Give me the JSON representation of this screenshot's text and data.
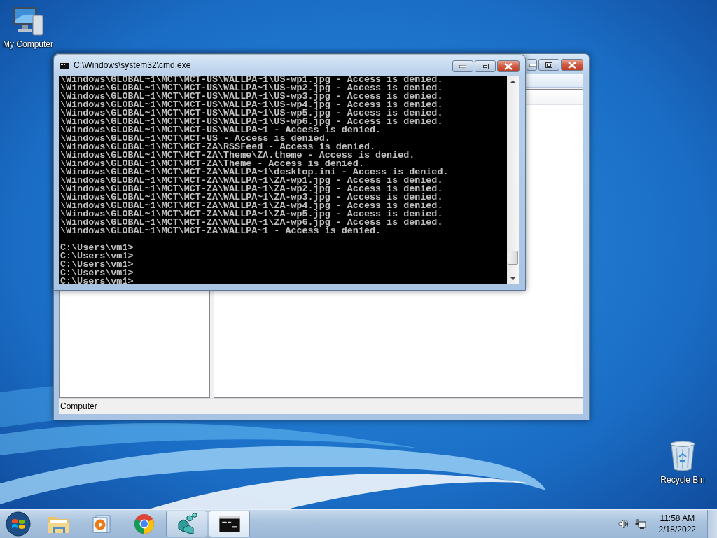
{
  "desktop": {
    "icons": [
      {
        "kind": "computer",
        "label": "My Computer"
      },
      {
        "kind": "recycle_bin",
        "label": "Recycle Bin"
      }
    ]
  },
  "background_window": {
    "status_bar": "Computer"
  },
  "console_window": {
    "title": "C:\\Windows\\system32\\cmd.exe",
    "output_lines": [
      "\\Windows\\GLOBAL~1\\MCT\\MCT-US\\WALLPA~1\\US-wp1.jpg - Access is denied.",
      "\\Windows\\GLOBAL~1\\MCT\\MCT-US\\WALLPA~1\\US-wp2.jpg - Access is denied.",
      "\\Windows\\GLOBAL~1\\MCT\\MCT-US\\WALLPA~1\\US-wp3.jpg - Access is denied.",
      "\\Windows\\GLOBAL~1\\MCT\\MCT-US\\WALLPA~1\\US-wp4.jpg - Access is denied.",
      "\\Windows\\GLOBAL~1\\MCT\\MCT-US\\WALLPA~1\\US-wp5.jpg - Access is denied.",
      "\\Windows\\GLOBAL~1\\MCT\\MCT-US\\WALLPA~1\\US-wp6.jpg - Access is denied.",
      "\\Windows\\GLOBAL~1\\MCT\\MCT-US\\WALLPA~1 - Access is denied.",
      "\\Windows\\GLOBAL~1\\MCT\\MCT-US - Access is denied.",
      "\\Windows\\GLOBAL~1\\MCT\\MCT-ZA\\RSSFeed - Access is denied.",
      "\\Windows\\GLOBAL~1\\MCT\\MCT-ZA\\Theme\\ZA.theme - Access is denied.",
      "\\Windows\\GLOBAL~1\\MCT\\MCT-ZA\\Theme - Access is denied.",
      "\\Windows\\GLOBAL~1\\MCT\\MCT-ZA\\WALLPA~1\\desktop.ini - Access is denied.",
      "\\Windows\\GLOBAL~1\\MCT\\MCT-ZA\\WALLPA~1\\ZA-wp1.jpg - Access is denied.",
      "\\Windows\\GLOBAL~1\\MCT\\MCT-ZA\\WALLPA~1\\ZA-wp2.jpg - Access is denied.",
      "\\Windows\\GLOBAL~1\\MCT\\MCT-ZA\\WALLPA~1\\ZA-wp3.jpg - Access is denied.",
      "\\Windows\\GLOBAL~1\\MCT\\MCT-ZA\\WALLPA~1\\ZA-wp4.jpg - Access is denied.",
      "\\Windows\\GLOBAL~1\\MCT\\MCT-ZA\\WALLPA~1\\ZA-wp5.jpg - Access is denied.",
      "\\Windows\\GLOBAL~1\\MCT\\MCT-ZA\\WALLPA~1\\ZA-wp6.jpg - Access is denied.",
      "\\Windows\\GLOBAL~1\\MCT\\MCT-ZA\\WALLPA~1 - Access is denied."
    ],
    "prompt_lines": [
      "C:\\Users\\vm1>",
      "C:\\Users\\vm1>",
      "C:\\Users\\vm1>",
      "C:\\Users\\vm1>",
      "C:\\Users\\vm1>"
    ]
  },
  "taskbar": {
    "items": [
      {
        "kind": "explorer",
        "running": false,
        "selected": false
      },
      {
        "kind": "media_player",
        "running": false,
        "selected": false
      },
      {
        "kind": "browser",
        "running": false,
        "selected": false
      },
      {
        "kind": "registry",
        "running": true,
        "selected": false
      },
      {
        "kind": "console",
        "running": true,
        "selected": true
      }
    ],
    "tray": {
      "time": "11:58 AM",
      "date": "2/18/2022"
    }
  }
}
